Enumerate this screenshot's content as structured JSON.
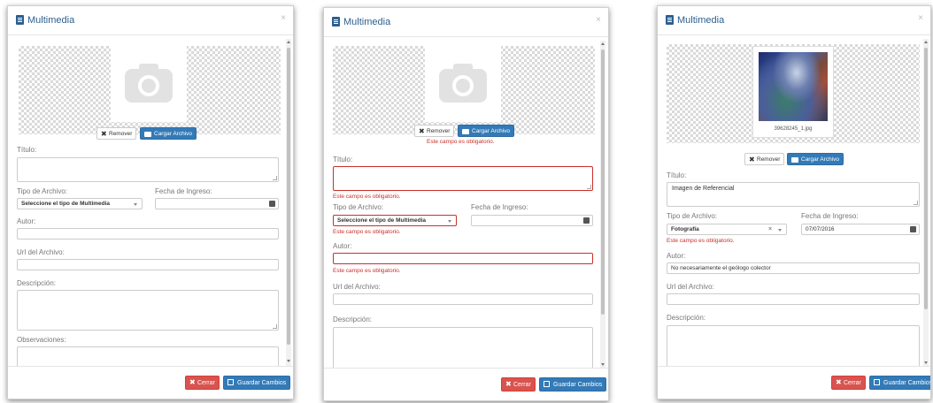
{
  "modal": {
    "title": "Multimedia",
    "close_symbol": "×",
    "icons": {
      "header": "document-icon",
      "camera": "camera-icon",
      "remove": "times-icon",
      "upload": "folder-open-icon",
      "calendar": "calendar-icon",
      "save": "floppy-disk-icon"
    },
    "colors": {
      "primary": "#337ab7",
      "danger": "#d9534f",
      "error_text": "#c9302c",
      "title_text": "#2d5f8f"
    }
  },
  "labels": {
    "remove": "Remover",
    "upload": "Cargar Archivo",
    "titulo": "Título:",
    "tipo": "Tipo de Archivo:",
    "fecha": "Fecha de Ingreso:",
    "autor": "Autor:",
    "url": "Url del Archivo:",
    "descripcion": "Descripción:",
    "observaciones": "Observaciones:",
    "cerrar": "Cerrar",
    "guardar": "Guardar Cambios",
    "required": "Este campo es obligatorio."
  },
  "select_placeholder": "Seleccione el tipo de Multimedia",
  "dialog3": {
    "file_name": "39628245_1.jpg",
    "titulo_value": "Imagen de Referencial",
    "tipo_value": "Fotografía",
    "fecha_value": "07/07/2016",
    "autor_value": "No necesariamente el geólogo colector",
    "clear_symbol": "×"
  }
}
